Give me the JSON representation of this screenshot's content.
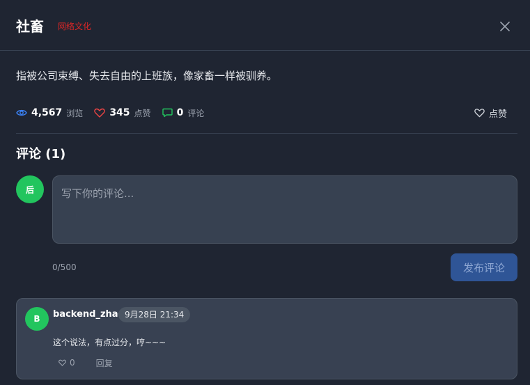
{
  "header": {
    "title": "社畜",
    "tag": "网络文化",
    "close_icon": "close-icon"
  },
  "description": "指被公司束缚、失去自由的上班族，像家畜一样被驯养。",
  "stats": {
    "views": {
      "value": "4,567",
      "label": "浏览",
      "icon": "eye-icon",
      "color": "#3b82f6"
    },
    "likes": {
      "value": "345",
      "label": "点赞",
      "icon": "heart-icon",
      "color": "#ef4444"
    },
    "comments": {
      "value": "0",
      "label": "评论",
      "icon": "comment-icon",
      "color": "#22c55e"
    }
  },
  "like_button": {
    "label": "点赞",
    "icon": "heart-outline-icon"
  },
  "comments_section": {
    "title": "评论 (1)",
    "my_avatar": "后",
    "input": {
      "placeholder": "写下你的评论...",
      "value": ""
    },
    "counter": "0/500",
    "submit_label": "发布评论"
  },
  "comments": [
    {
      "avatar": "B",
      "user": "backend_zhao",
      "time": "9月28日 21:34",
      "text": "这个说法，有点过分，哼~~~",
      "likes": "0",
      "reply_label": "回复"
    }
  ],
  "colors": {
    "background": "#1f2532",
    "accent": "#2f5596",
    "avatar": "#22c55e",
    "tag": "#dc2626"
  }
}
